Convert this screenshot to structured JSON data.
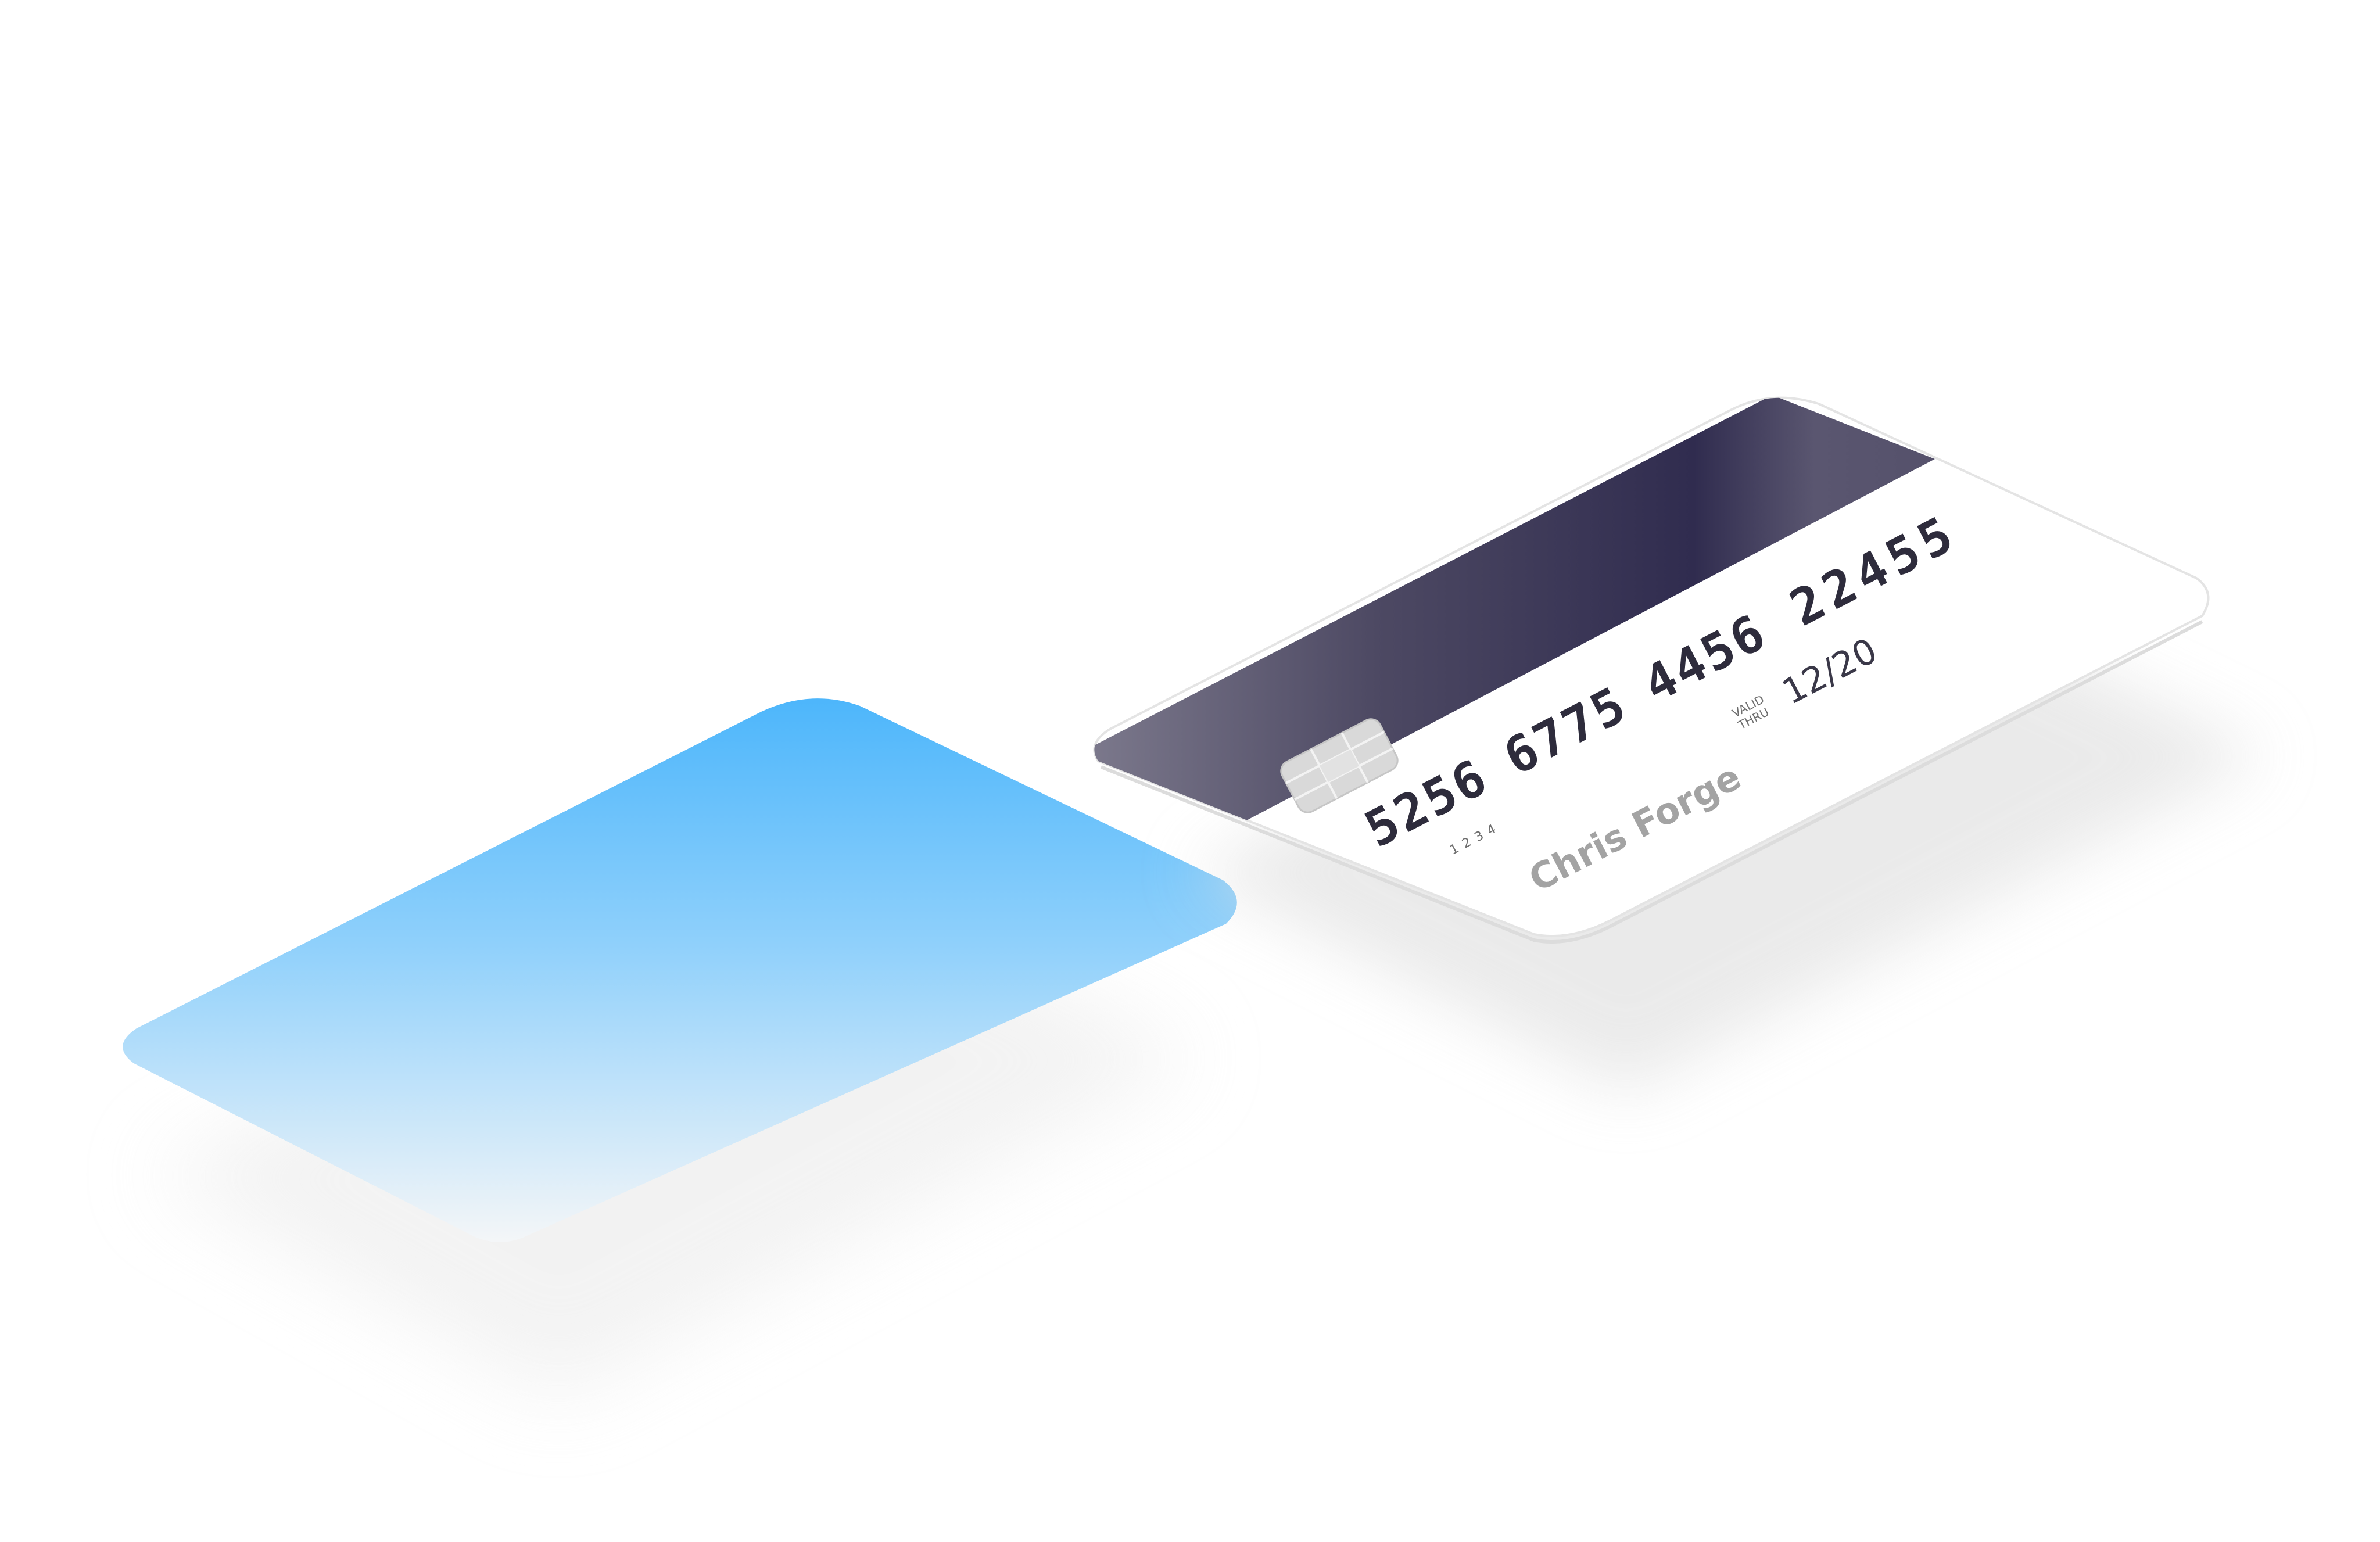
{
  "card": {
    "number_groups": [
      "5256",
      "6775",
      "4456",
      "22455"
    ],
    "small_code": "1234",
    "valid_label_line1": "VALID",
    "valid_label_line2": "THRU",
    "expiry": "12/20",
    "holder_name": "Chris Forge"
  },
  "colors": {
    "stripe_dark": "#302c4f",
    "stripe_light": "#7c7a8e",
    "card_face": "#ffffff",
    "number_text": "#2e2c3c",
    "holder_text": "#a3a3a3",
    "chip": "#d9d9d9",
    "blue_card_top": "#4db6fb",
    "blue_card_bottom": "#f2f6fa"
  }
}
